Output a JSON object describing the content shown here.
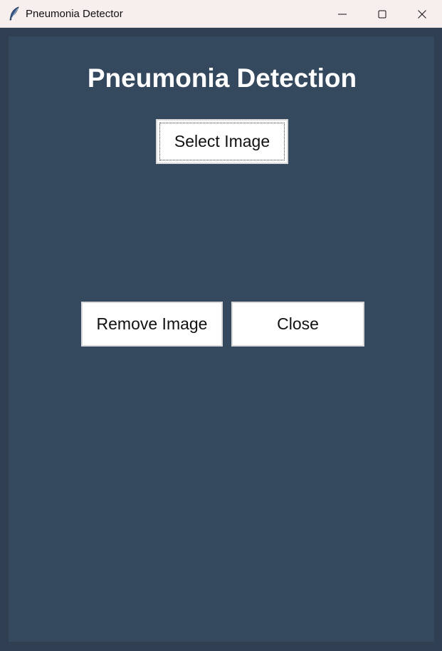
{
  "window": {
    "title": "Pneumonia Detector",
    "controls": {
      "minimize": "minimize-icon",
      "maximize": "maximize-icon",
      "close": "close-icon"
    },
    "app_icon": "feather-icon"
  },
  "main": {
    "heading": "Pneumonia Detection",
    "select_button": "Select Image",
    "remove_button": "Remove Image",
    "close_button": "Close"
  },
  "colors": {
    "frame_background": "#2f3e50",
    "content_background": "#34495e",
    "titlebar_background": "#f7eeee",
    "heading_text": "#ffffff",
    "button_background": "#ffffff"
  }
}
